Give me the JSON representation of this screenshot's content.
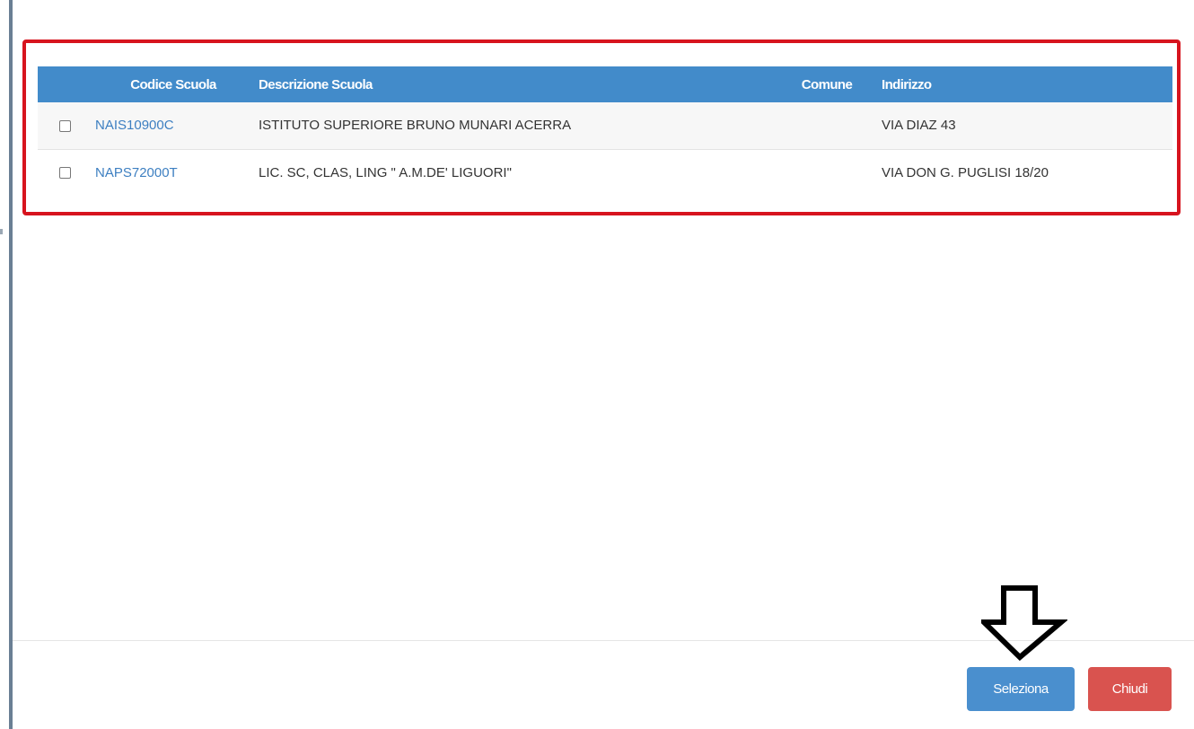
{
  "table": {
    "headers": {
      "code": "Codice Scuola",
      "description": "Descrizione Scuola",
      "city": "Comune",
      "address": "Indirizzo"
    },
    "rows": [
      {
        "code": "NAIS10900C",
        "description": "ISTITUTO SUPERIORE BRUNO MUNARI ACERRA",
        "city": "",
        "address": "VIA DIAZ 43",
        "checked": false
      },
      {
        "code": "NAPS72000T",
        "description": "LIC. SC, CLAS, LING \" A.M.DE' LIGUORI\"",
        "city": "",
        "address": "VIA DON G. PUGLISI 18/20",
        "checked": false
      }
    ]
  },
  "footer": {
    "select_label": "Seleziona",
    "close_label": "Chiudi"
  },
  "colors": {
    "header_bg": "#428bca",
    "highlight_border": "#d7141e",
    "select_button": "#4a8fce",
    "close_button": "#d9534f",
    "link": "#3d7fc1"
  },
  "annotation": {
    "icon": "down-arrow-icon"
  }
}
